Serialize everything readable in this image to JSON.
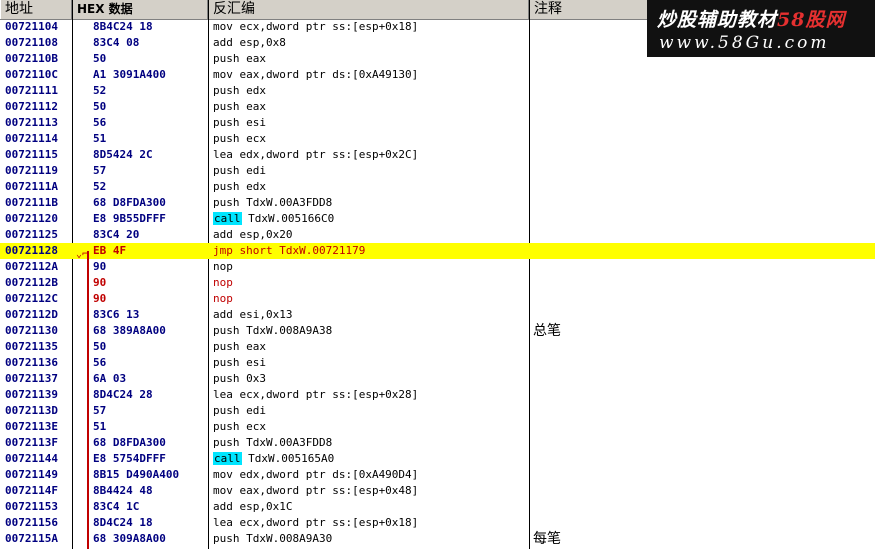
{
  "columns": {
    "address": "地址",
    "hex": "HEX 数据",
    "disassembly": "反汇编",
    "comment": "注释"
  },
  "rows": [
    {
      "address": "00721104",
      "hex": "8B4C24 18",
      "ins": "mov ecx,dword ptr ss:[esp+0x18]",
      "kw": "",
      "comment": ""
    },
    {
      "address": "00721108",
      "hex": "83C4 08",
      "ins": "add esp,0x8",
      "kw": "",
      "comment": ""
    },
    {
      "address": "0072110B",
      "hex": "50",
      "ins": "push eax",
      "kw": "",
      "comment": ""
    },
    {
      "address": "0072110C",
      "hex": "A1 3091A400",
      "ins": "mov eax,dword ptr ds:[0xA49130]",
      "kw": "",
      "comment": ""
    },
    {
      "address": "00721111",
      "hex": "52",
      "ins": "push edx",
      "kw": "",
      "comment": ""
    },
    {
      "address": "00721112",
      "hex": "50",
      "ins": "push eax",
      "kw": "",
      "comment": ""
    },
    {
      "address": "00721113",
      "hex": "56",
      "ins": "push esi",
      "kw": "",
      "comment": ""
    },
    {
      "address": "00721114",
      "hex": "51",
      "ins": "push ecx",
      "kw": "",
      "comment": ""
    },
    {
      "address": "00721115",
      "hex": "8D5424 2C",
      "ins": "lea edx,dword ptr ss:[esp+0x2C]",
      "kw": "",
      "comment": ""
    },
    {
      "address": "00721119",
      "hex": "57",
      "ins": "push edi",
      "kw": "",
      "comment": ""
    },
    {
      "address": "0072111A",
      "hex": "52",
      "ins": "push edx",
      "kw": "",
      "comment": ""
    },
    {
      "address": "0072111B",
      "hex": "68 D8FDA300",
      "ins": "push TdxW.00A3FDD8",
      "kw": "",
      "comment": ""
    },
    {
      "address": "00721120",
      "hex": "E8 9B55DFFF",
      "ins": " TdxW.005166C0",
      "kw": "call",
      "comment": ""
    },
    {
      "address": "00721125",
      "hex": "83C4 20",
      "ins": "add esp,0x20",
      "kw": "",
      "comment": ""
    },
    {
      "address": "00721128",
      "hex": "EB 4F",
      "ins": "jmp short TdxW.00721179",
      "kw": "",
      "comment": "",
      "highlight": true
    },
    {
      "address": "0072112A",
      "hex": "90",
      "ins": "nop",
      "kw": "",
      "comment": ""
    },
    {
      "address": "0072112B",
      "hex": "90",
      "ins": "nop",
      "kw": "",
      "comment": "",
      "red": true
    },
    {
      "address": "0072112C",
      "hex": "90",
      "ins": "nop",
      "kw": "",
      "comment": "",
      "red": true
    },
    {
      "address": "0072112D",
      "hex": "83C6 13",
      "ins": "add esi,0x13",
      "kw": "",
      "comment": ""
    },
    {
      "address": "00721130",
      "hex": "68 389A8A00",
      "ins": "push TdxW.008A9A38",
      "kw": "",
      "comment": "总笔"
    },
    {
      "address": "00721135",
      "hex": "50",
      "ins": "push eax",
      "kw": "",
      "comment": ""
    },
    {
      "address": "00721136",
      "hex": "56",
      "ins": "push esi",
      "kw": "",
      "comment": ""
    },
    {
      "address": "00721137",
      "hex": "6A 03",
      "ins": "push 0x3",
      "kw": "",
      "comment": ""
    },
    {
      "address": "00721139",
      "hex": "8D4C24 28",
      "ins": "lea ecx,dword ptr ss:[esp+0x28]",
      "kw": "",
      "comment": ""
    },
    {
      "address": "0072113D",
      "hex": "57",
      "ins": "push edi",
      "kw": "",
      "comment": ""
    },
    {
      "address": "0072113E",
      "hex": "51",
      "ins": "push ecx",
      "kw": "",
      "comment": ""
    },
    {
      "address": "0072113F",
      "hex": "68 D8FDA300",
      "ins": "push TdxW.00A3FDD8",
      "kw": "",
      "comment": ""
    },
    {
      "address": "00721144",
      "hex": "E8 5754DFFF",
      "ins": " TdxW.005165A0",
      "kw": "call",
      "comment": ""
    },
    {
      "address": "00721149",
      "hex": "8B15 D490A400",
      "ins": "mov edx,dword ptr ds:[0xA490D4]",
      "kw": "",
      "comment": ""
    },
    {
      "address": "0072114F",
      "hex": "8B4424 48",
      "ins": "mov eax,dword ptr ss:[esp+0x48]",
      "kw": "",
      "comment": ""
    },
    {
      "address": "00721153",
      "hex": "83C4 1C",
      "ins": "add esp,0x1C",
      "kw": "",
      "comment": ""
    },
    {
      "address": "00721156",
      "hex": "8D4C24 18",
      "ins": "lea ecx,dword ptr ss:[esp+0x18]",
      "kw": "",
      "comment": ""
    },
    {
      "address": "0072115A",
      "hex": "68 309A8A00",
      "ins": "push TdxW.008A9A30",
      "kw": "",
      "comment": "每笔"
    }
  ],
  "watermark": {
    "line1_a": "炒股辅助教材",
    "line1_b": "58股网",
    "line2": "www.58Gu.com"
  },
  "jump_marker": "⌄⌐"
}
